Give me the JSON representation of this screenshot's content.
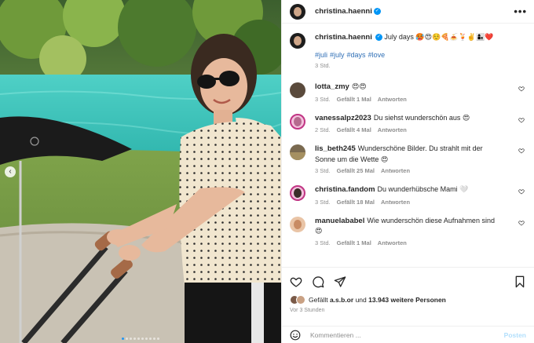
{
  "post": {
    "username": "christina.haenni",
    "verified_mark": "✓",
    "more_label": "•••"
  },
  "caption": {
    "username": "christina.haenni",
    "text": "July days 🥵😍☺️🍕🍝🍹✌️👩‍👦❤️",
    "hashtags": [
      "#juli",
      "#july",
      "#days",
      "#love"
    ],
    "time": "3 Std."
  },
  "comments": [
    {
      "username": "lotta_zmy",
      "text": "😍😍",
      "time": "3 Std.",
      "likes": "Gefällt 1 Mal",
      "reply": "Antworten",
      "avatar_color": "#5a4a3c"
    },
    {
      "username": "vanessalpz2023",
      "text": "Du siehst wunderschön aus 😍",
      "time": "2 Std.",
      "likes": "Gefällt 4 Mal",
      "reply": "Antworten",
      "avatar_color": "#b56a8e"
    },
    {
      "username": "lis_beth245",
      "text": "Wunderschöne Bilder. Du strahlt mit der Sonne um die Wette 😍",
      "time": "3 Std.",
      "likes": "Gefällt 25 Mal",
      "reply": "Antworten",
      "avatar_color": "#7a6a50"
    },
    {
      "username": "christina.fandom",
      "text": "Du wunderhübsche Mami 🤍",
      "time": "3 Std.",
      "likes": "Gefällt 18 Mal",
      "reply": "Antworten",
      "avatar_color": "#3b2c28"
    },
    {
      "username": "manuelababel",
      "text": "Wie wunderschön diese Aufnahmen sind 😍",
      "time": "3 Std.",
      "likes": "Gefällt 1 Mal",
      "reply": "Antworten",
      "avatar_color": "#c88b63"
    }
  ],
  "likes": {
    "prefix": "Gefällt",
    "first_user": "a.s.b.or",
    "conjunction": "und",
    "others": "13.943 weitere Personen"
  },
  "date": "Vor 3 Stunden",
  "add_comment": {
    "placeholder": "Kommentieren ...",
    "post_label": "Posten"
  },
  "carousel": {
    "total": 10,
    "active_index": 0
  },
  "colors": {
    "verified": "#0095f6",
    "hashtag": "#2f6fb6",
    "meta_gray": "#8e8e8e",
    "post_disabled": "#b2dffc"
  },
  "icons": {
    "header_more": "more-horizontal-icon",
    "comment_like": "heart-outline-icon",
    "like": "heart-icon",
    "comment": "comment-bubble-icon",
    "share": "paper-plane-icon",
    "save": "bookmark-icon",
    "emoji": "emoji-smiley-icon",
    "prev": "chevron-left-icon"
  }
}
